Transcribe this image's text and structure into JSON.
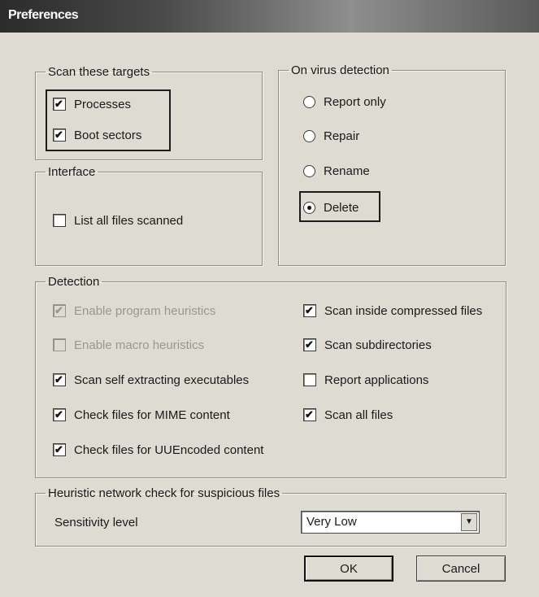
{
  "window": {
    "title": "Preferences"
  },
  "scan_targets": {
    "legend": "Scan these targets",
    "items": [
      {
        "label": "Processes",
        "checked": true
      },
      {
        "label": "Boot sectors",
        "checked": true
      }
    ]
  },
  "interface": {
    "legend": "Interface",
    "items": [
      {
        "label": "List all files scanned",
        "checked": false
      }
    ]
  },
  "virus_detection": {
    "legend": "On virus detection",
    "options": [
      {
        "label": "Report only",
        "selected": false
      },
      {
        "label": "Repair",
        "selected": false
      },
      {
        "label": "Rename",
        "selected": false
      },
      {
        "label": "Delete",
        "selected": true
      }
    ]
  },
  "detection": {
    "legend": "Detection",
    "left": [
      {
        "label": "Enable program heuristics",
        "checked": true,
        "disabled": true
      },
      {
        "label": "Enable macro heuristics",
        "checked": false,
        "disabled": true
      },
      {
        "label": "Scan self extracting executables",
        "checked": true,
        "disabled": false
      },
      {
        "label": "Check files for MIME content",
        "checked": true,
        "disabled": false
      },
      {
        "label": "Check files for UUEncoded content",
        "checked": true,
        "disabled": false
      }
    ],
    "right": [
      {
        "label": "Scan inside compressed files",
        "checked": true
      },
      {
        "label": "Scan subdirectories",
        "checked": true
      },
      {
        "label": "Report applications",
        "checked": false
      },
      {
        "label": "Scan all files",
        "checked": true
      }
    ]
  },
  "heuristic": {
    "legend": "Heuristic network check for suspicious files",
    "sensitivity_label": "Sensitivity level",
    "sensitivity_value": "Very Low"
  },
  "buttons": {
    "ok": "OK",
    "cancel": "Cancel"
  }
}
